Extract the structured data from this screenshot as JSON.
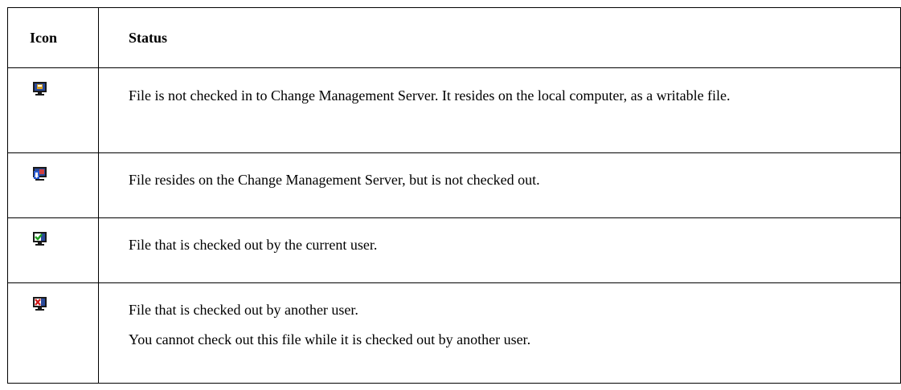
{
  "table": {
    "headers": {
      "icon": "Icon",
      "status": "Status"
    },
    "rows": [
      {
        "icon": "monitor-local-file-icon",
        "text": "File is not checked in to Change Management Server. It resides on the local computer, as a writable file."
      },
      {
        "icon": "monitor-server-file-icon",
        "text": "File resides on the Change Management Server, but is not checked out."
      },
      {
        "icon": "monitor-checked-out-current-user-icon",
        "text": "File that is checked out by the current user."
      },
      {
        "icon": "monitor-checked-out-other-user-icon",
        "text": "File that is checked out by another user.",
        "note": "You cannot check out this file while it is checked out by another user."
      }
    ]
  },
  "colors": {
    "monitor_frame": "#1a1a1a",
    "screen_blue": "#2a4a9a",
    "check_green": "#1fa01f",
    "cross_red": "#d01818",
    "screen_white": "#ffffff"
  }
}
